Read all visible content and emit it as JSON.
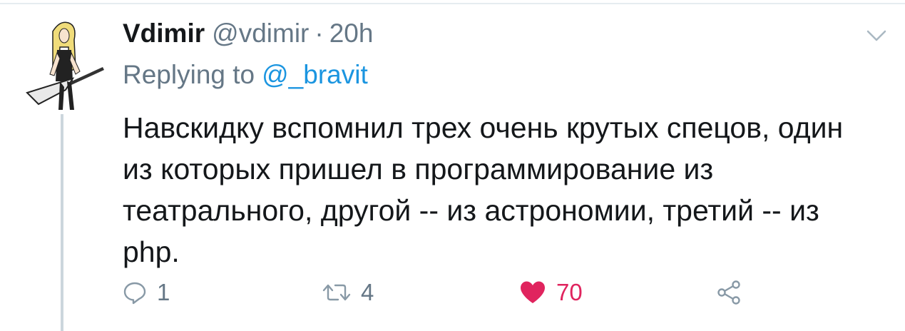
{
  "tweet": {
    "display_name": "Vdimir",
    "handle": "@vdimir",
    "separator": "·",
    "time": "20h",
    "reply_prefix": "Replying to",
    "reply_to": "@_bravit",
    "text": "Навскидку вспомнил трех очень крутых спецов, один из которых пришел в программирование из театрального, другой -- из астрономии, третий -- из php.",
    "avatar_icon": "guitarist-avatar",
    "menu_icon": "chevron-down-icon"
  },
  "actions": {
    "reply": {
      "icon": "reply-icon",
      "count": "1"
    },
    "retweet": {
      "icon": "retweet-icon",
      "count": "4"
    },
    "like": {
      "icon": "heart-icon",
      "count": "70",
      "color": "#e0245e",
      "liked": true
    },
    "share": {
      "icon": "share-icon"
    }
  },
  "colors": {
    "text": "#14171a",
    "secondary": "#657786",
    "link": "#1b95e0",
    "thread_line": "#ccd6dd"
  }
}
